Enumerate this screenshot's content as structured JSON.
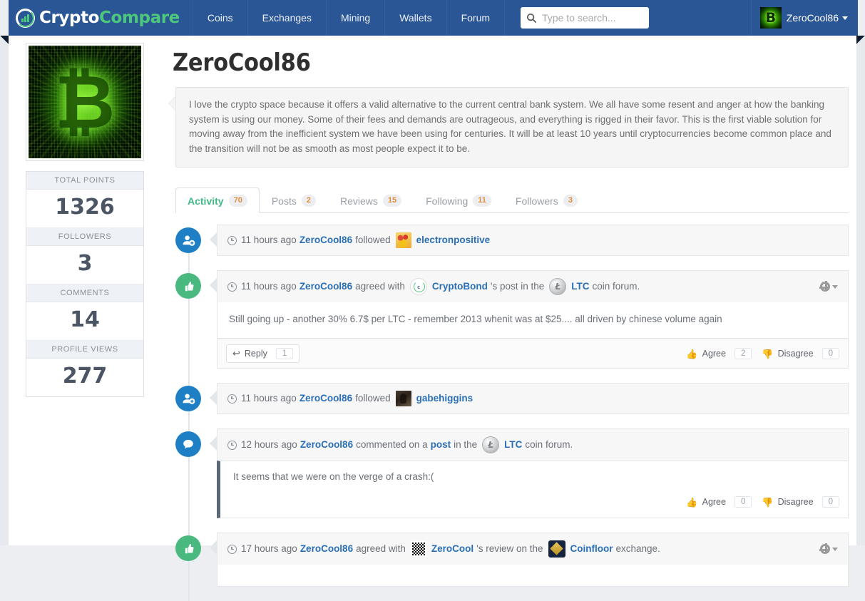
{
  "nav": {
    "brand_part1": "Crypto",
    "brand_part2": "Compare",
    "items": [
      {
        "label": "Coins"
      },
      {
        "label": "Exchanges"
      },
      {
        "label": "Mining"
      },
      {
        "label": "Wallets"
      },
      {
        "label": "Forum"
      }
    ],
    "search_placeholder": "Type to search...",
    "search_value": "",
    "user_name": "ZeroCool86"
  },
  "profile": {
    "title": "ZeroCool86",
    "bio": "I love the crypto space because it offers a valid alternative to the current central bank system. We all have some resent and anger at how the banking system is using our money. Some of their fees and demands are outrageous, and everything is rigged in their favor. This is the first viable solution for moving away from the inefficient system we have been using for centuries. It will be at least 10 years until cryptocurrencies become common place and the transition will not be as smooth as most people expect it to be."
  },
  "stats": [
    {
      "label": "TOTAL POINTS",
      "value": "1326"
    },
    {
      "label": "FOLLOWERS",
      "value": "3"
    },
    {
      "label": "COMMENTS",
      "value": "14"
    },
    {
      "label": "PROFILE VIEWS",
      "value": "277"
    }
  ],
  "tabs": [
    {
      "label": "Activity",
      "count": "70",
      "active": true
    },
    {
      "label": "Posts",
      "count": "2",
      "active": false
    },
    {
      "label": "Reviews",
      "count": "15",
      "active": false
    },
    {
      "label": "Following",
      "count": "11",
      "active": false
    },
    {
      "label": "Followers",
      "count": "3",
      "active": false
    }
  ],
  "activities": [
    {
      "time": "11 hours ago",
      "actor": "ZeroCool86",
      "verb": "followed",
      "target_user": "electronpositive"
    },
    {
      "time": "11 hours ago",
      "actor": "ZeroCool86",
      "verb": "agreed with",
      "target_user": "CryptoBond",
      "mid": "'s post in the",
      "coin": "LTC",
      "tail": "coin forum.",
      "body": "Still going up - another 30% 6.7$ per LTC - remember 2013 whenit was at $25.... all driven by chinese volume again",
      "reply_label": "Reply",
      "reply_count": "1",
      "agree_label": "Agree",
      "agree_count": "2",
      "disagree_label": "Disagree",
      "disagree_count": "0"
    },
    {
      "time": "11 hours ago",
      "actor": "ZeroCool86",
      "verb": "followed",
      "target_user": "gabehiggins"
    },
    {
      "time": "12 hours ago",
      "actor": "ZeroCool86",
      "verb": "commented on a",
      "link_word": "post",
      "mid": "in the",
      "coin": "LTC",
      "tail": "coin forum.",
      "body": "It seems that we were on the verge of a crash:(",
      "agree_label": "Agree",
      "agree_count": "0",
      "disagree_label": "Disagree",
      "disagree_count": "0"
    },
    {
      "time": "17 hours ago",
      "actor": "ZeroCool86",
      "verb": "agreed with",
      "target_user": "ZeroCool",
      "mid": "'s review on the",
      "exchange": "Coinfloor",
      "tail": "exchange."
    }
  ],
  "colors": {
    "nav_bg": "#2b5695",
    "brand_green": "#4cc77c",
    "link_blue": "#2a6fb5",
    "badge_orange": "#e08e3c",
    "active_tab_green": "#41b883",
    "agree_green": "#49b97f",
    "disagree_red": "#e8544f"
  }
}
